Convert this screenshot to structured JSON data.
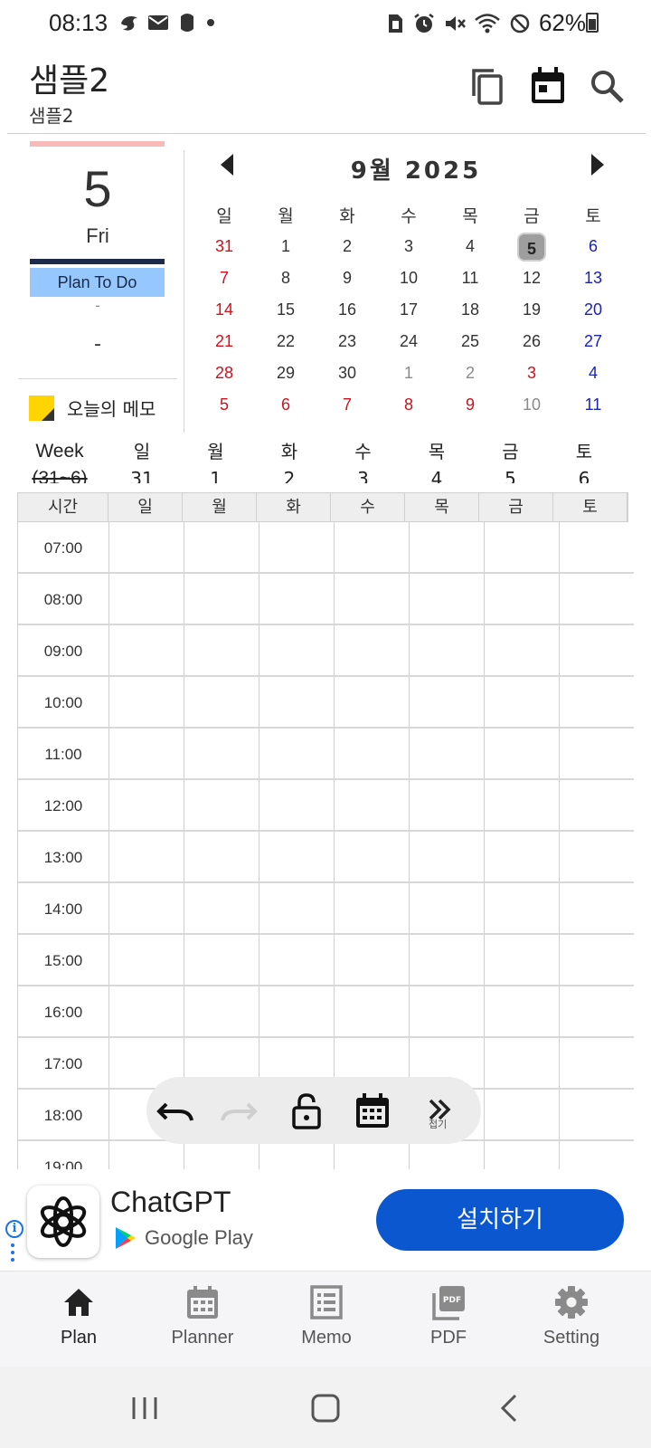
{
  "status_bar": {
    "time": "08:13",
    "battery": "62%",
    "left_icons": [
      "swift-icon",
      "mail-icon",
      "app-icon",
      "dot-icon"
    ],
    "right_icons": [
      "sim-icon",
      "alarm-icon",
      "mute-icon",
      "wifi-icon",
      "dnd-icon",
      "battery-icon"
    ]
  },
  "header": {
    "title": "샘플2",
    "subtitle": "샘플2",
    "icons": [
      "copy-icon",
      "calendar-icon",
      "search-icon"
    ]
  },
  "left_panel": {
    "day": "5",
    "weekday": "Fri",
    "plan_label": "Plan To Do",
    "dash_small": "-",
    "dash_large": "-",
    "memo_label": "오늘의 메모",
    "colors": {
      "top_bar": "#f8b9b9",
      "dark_bar": "#1e2a4a",
      "plan_bg": "#96c7ff",
      "memo_icon": "#ffd400"
    }
  },
  "calendar": {
    "title": "9월 2025",
    "weekdays": [
      "일",
      "월",
      "화",
      "수",
      "목",
      "금",
      "토"
    ],
    "weeks": [
      [
        "31",
        "1",
        "2",
        "3",
        "4",
        "5",
        "6"
      ],
      [
        "7",
        "8",
        "9",
        "10",
        "11",
        "12",
        "13"
      ],
      [
        "14",
        "15",
        "16",
        "17",
        "18",
        "19",
        "20"
      ],
      [
        "21",
        "22",
        "23",
        "24",
        "25",
        "26",
        "27"
      ],
      [
        "28",
        "29",
        "30",
        "1",
        "2",
        "3",
        "4"
      ],
      [
        "5",
        "6",
        "7",
        "8",
        "9",
        "10",
        "11"
      ]
    ],
    "colors": {
      "sunday": "#d0101a",
      "saturday": "#1a22b5",
      "other_month": "#8a8a8a",
      "today_bg": "#9e9e9e"
    }
  },
  "week_strip": {
    "label_line1": "Week",
    "label_line2": "(31~6)",
    "days": [
      {
        "name": "일",
        "num": "31"
      },
      {
        "name": "월",
        "num": "1"
      },
      {
        "name": "화",
        "num": "2"
      },
      {
        "name": "수",
        "num": "3"
      },
      {
        "name": "목",
        "num": "4"
      },
      {
        "name": "금",
        "num": "5"
      },
      {
        "name": "토",
        "num": "6"
      }
    ]
  },
  "timetable": {
    "headers": [
      "시간",
      "일",
      "월",
      "화",
      "수",
      "목",
      "금",
      "토"
    ],
    "times": [
      "07:00",
      "08:00",
      "09:00",
      "10:00",
      "11:00",
      "12:00",
      "13:00",
      "14:00",
      "15:00",
      "16:00",
      "17:00",
      "18:00",
      "19:00"
    ]
  },
  "floating_toolbar": {
    "items": [
      "undo-icon",
      "redo-icon",
      "unlock-icon",
      "calendar-icon",
      "more-icon"
    ],
    "more_label": "접기"
  },
  "ad": {
    "app_name": "ChatGPT",
    "store_name": "Google Play",
    "install_label": "설치하기",
    "colors": {
      "button": "#0b57d0"
    }
  },
  "bottom_nav": {
    "items": [
      {
        "label": "Plan",
        "icon": "home-icon"
      },
      {
        "label": "Planner",
        "icon": "calendar-icon"
      },
      {
        "label": "Memo",
        "icon": "memo-icon"
      },
      {
        "label": "PDF",
        "icon": "pdf-icon"
      },
      {
        "label": "Setting",
        "icon": "gear-icon"
      }
    ],
    "active": "Plan"
  },
  "system_nav": {
    "items": [
      "recents-icon",
      "home-icon",
      "back-icon"
    ]
  }
}
